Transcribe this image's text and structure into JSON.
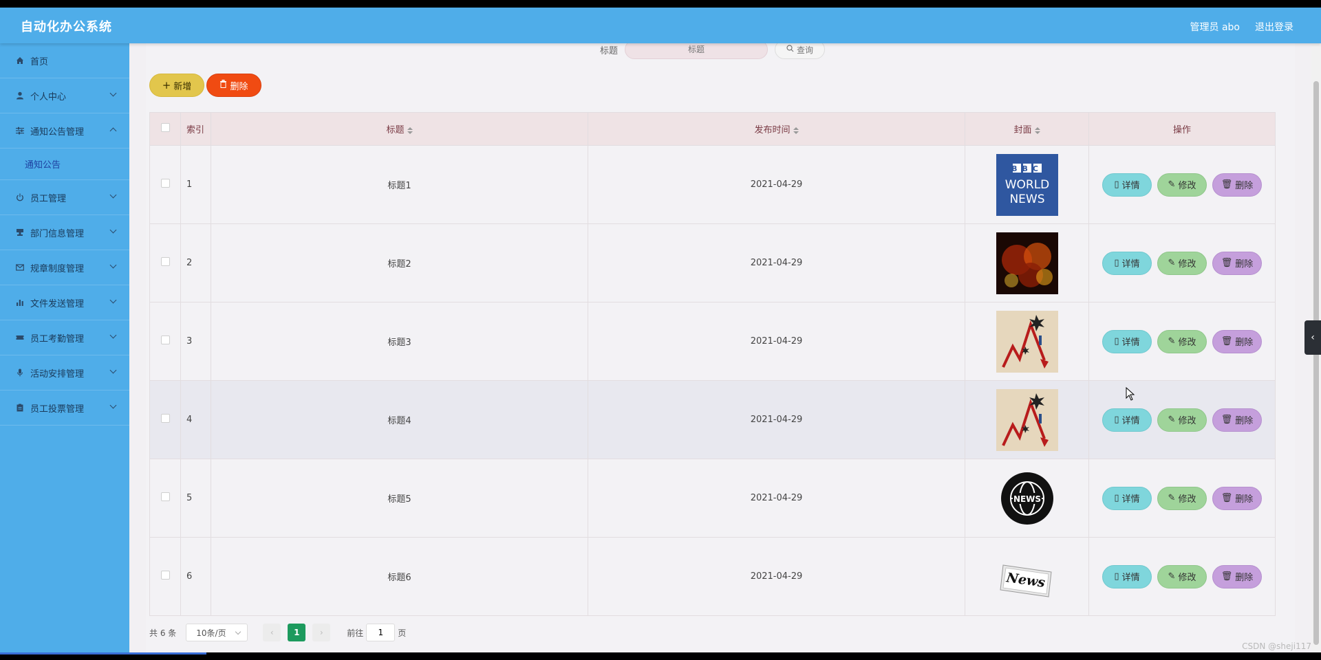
{
  "header": {
    "app_title": "自动化办公系统",
    "user_label": "管理员 abo",
    "logout": "退出登录"
  },
  "sidebar": {
    "items": [
      {
        "label": "首页",
        "icon": "home-icon",
        "expandable": false
      },
      {
        "label": "个人中心",
        "icon": "user-icon",
        "expandable": true
      },
      {
        "label": "通知公告管理",
        "icon": "sliders-icon",
        "expandable": true,
        "expanded": true
      },
      {
        "label": "员工管理",
        "icon": "power-icon",
        "expandable": true
      },
      {
        "label": "部门信息管理",
        "icon": "stamp-icon",
        "expandable": true
      },
      {
        "label": "规章制度管理",
        "icon": "envelope-icon",
        "expandable": true
      },
      {
        "label": "文件发送管理",
        "icon": "bar-chart-icon",
        "expandable": true
      },
      {
        "label": "员工考勤管理",
        "icon": "ticket-icon",
        "expandable": true
      },
      {
        "label": "活动安排管理",
        "icon": "microphone-icon",
        "expandable": true
      },
      {
        "label": "员工投票管理",
        "icon": "clipboard-icon",
        "expandable": true
      }
    ],
    "subitem": "通知公告"
  },
  "search": {
    "label": "标题",
    "placeholder": "标题",
    "button": "查询"
  },
  "toolbar": {
    "add": "新增",
    "delete": "删除"
  },
  "table": {
    "columns": [
      "索引",
      "标题",
      "发布时间",
      "封面",
      "操作"
    ],
    "rows": [
      {
        "index": "1",
        "title": "标题1",
        "date": "2021-04-29",
        "cover": "bbc-world-news"
      },
      {
        "index": "2",
        "title": "标题2",
        "date": "2021-04-29",
        "cover": "money-fire"
      },
      {
        "index": "3",
        "title": "标题3",
        "date": "2021-04-29",
        "cover": "falling-chart"
      },
      {
        "index": "4",
        "title": "标题4",
        "date": "2021-04-29",
        "cover": "falling-chart"
      },
      {
        "index": "5",
        "title": "标题5",
        "date": "2021-04-29",
        "cover": "news-globe"
      },
      {
        "index": "6",
        "title": "标题6",
        "date": "2021-04-29",
        "cover": "newspaper"
      }
    ],
    "actions": {
      "detail": "详情",
      "edit": "修改",
      "remove": "删除"
    }
  },
  "pagination": {
    "total": "共 6 条",
    "page_size": "10条/页",
    "current_page": "1",
    "goto_prefix": "前往",
    "goto_value": "1",
    "goto_suffix": "页"
  },
  "covers": {
    "bbc_line1": "BBC",
    "bbc_line2": "WORLD",
    "bbc_line3": "NEWS",
    "globe_text": "NEWS",
    "paper_text": "News"
  },
  "watermark": "CSDN @sheji117"
}
